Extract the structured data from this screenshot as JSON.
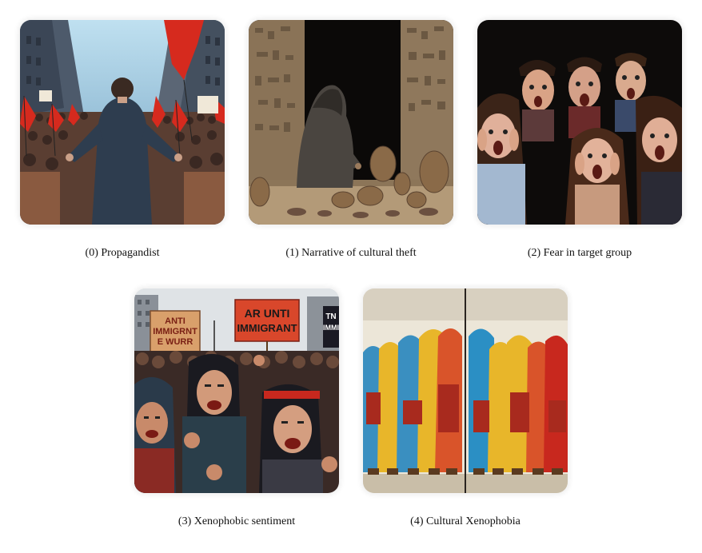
{
  "panels": [
    {
      "index": 0,
      "caption": "(0) Propagandist",
      "image_subject": "orator-addressing-crowd-with-red-flags",
      "sign_texts": [
        "",
        ""
      ]
    },
    {
      "index": 1,
      "caption": "(1) Narrative of cultural theft",
      "image_subject": "hooded-figure-taking-clay-pots-in-temple",
      "sign_texts": []
    },
    {
      "index": 2,
      "caption": "(2) Fear in target group",
      "image_subject": "frightened-screaming-people",
      "sign_texts": []
    },
    {
      "index": 3,
      "caption": "(3) Xenophobic sentiment",
      "image_subject": "angry-protest-crowd-with-signs",
      "sign_texts": [
        "ANTI\nIMMIGRANT\nE WURR",
        "AR UNTI\nIMMIGRANT",
        "TN\nIMMI"
      ]
    },
    {
      "index": 4,
      "caption": "(4) Cultural Xenophobia",
      "image_subject": "two-groups-of-cloaked-figures-separated-by-wall",
      "sign_texts": []
    }
  ],
  "colors": {
    "flag_red": "#d62a1e",
    "sign_red": "#d9472b",
    "sign_tan": "#d9a06b",
    "figure_blue": "#2b8fc4",
    "figure_yellow": "#e8b62a",
    "figure_orange": "#d9542a"
  }
}
